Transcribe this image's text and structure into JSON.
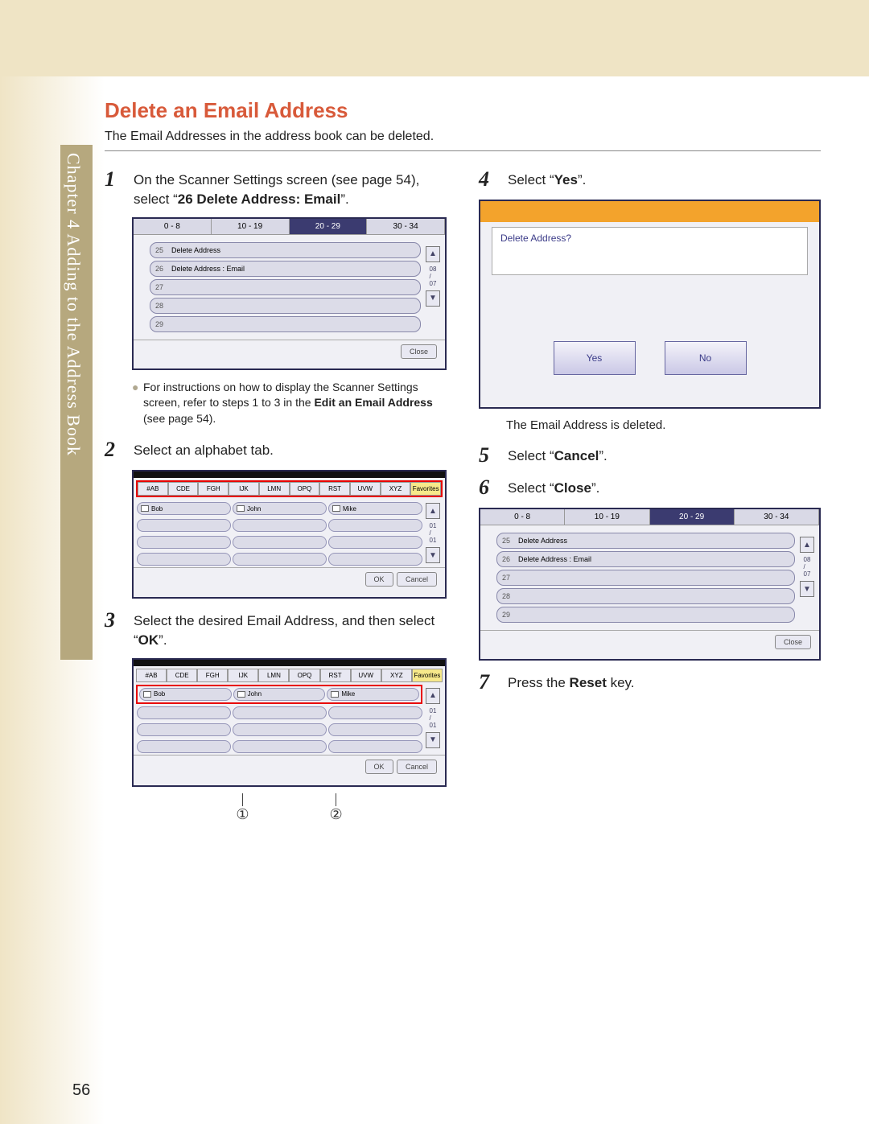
{
  "sidebar": {
    "label": "Chapter 4    Adding to the Address Book"
  },
  "title": "Delete an Email Address",
  "intro": "The Email Addresses in the address book can be deleted.",
  "steps": {
    "s1": {
      "num": "1",
      "text_a": "On the Scanner Settings screen (see page 54), select “",
      "text_b": "26 Delete Address: Email",
      "text_c": "”."
    },
    "s1_note": {
      "text_a": "For instructions on how to display the Scanner Settings screen, refer to steps 1 to 3 in the ",
      "text_b": "Edit an Email Address",
      "text_c": " (see page 54)."
    },
    "s2": {
      "num": "2",
      "text": "Select an alphabet tab."
    },
    "s3": {
      "num": "3",
      "text_a": "Select the desired Email Address, and then select “",
      "text_b": "OK",
      "text_c": "”."
    },
    "s4": {
      "num": "4",
      "text_a": "Select “",
      "text_b": "Yes",
      "text_c": "”."
    },
    "s4_result": "The Email Address is deleted.",
    "s5": {
      "num": "5",
      "text_a": "Select “",
      "text_b": "Cancel",
      "text_c": "”."
    },
    "s6": {
      "num": "6",
      "text_a": "Select “",
      "text_b": "Close",
      "text_c": "”."
    },
    "s7": {
      "num": "7",
      "text_a": "Press the ",
      "text_b": "Reset",
      "text_c": " key."
    }
  },
  "mock1": {
    "tabs": [
      "0 - 8",
      "10 - 19",
      "20 - 29",
      "30 - 34"
    ],
    "rows": [
      {
        "n": "25",
        "t": "Delete Address"
      },
      {
        "n": "26",
        "t": "Delete Address : Email"
      },
      {
        "n": "27",
        "t": ""
      },
      {
        "n": "28",
        "t": ""
      },
      {
        "n": "29",
        "t": ""
      }
    ],
    "close": "Close",
    "pager": "08\n/\n07"
  },
  "mock2": {
    "tabs": [
      "#AB",
      "CDE",
      "FGH",
      "IJK",
      "LMN",
      "OPQ",
      "RST",
      "UVW",
      "XYZ",
      "Favorites"
    ],
    "names": [
      "Bob",
      "John",
      "Mike"
    ],
    "ok": "OK",
    "cancel": "Cancel",
    "pager": "01\n/\n01"
  },
  "mock3": {
    "names": [
      "Bob",
      "John",
      "Mike"
    ],
    "ok": "OK",
    "cancel": "Cancel",
    "callout1": "①",
    "callout2": "②"
  },
  "mock4": {
    "question": "Delete Address?",
    "yes": "Yes",
    "no": "No"
  },
  "mock5": {
    "tabs": [
      "0 - 8",
      "10 - 19",
      "20 - 29",
      "30 - 34"
    ],
    "rows": [
      {
        "n": "25",
        "t": "Delete Address"
      },
      {
        "n": "26",
        "t": "Delete Address : Email"
      },
      {
        "n": "27",
        "t": ""
      },
      {
        "n": "28",
        "t": ""
      },
      {
        "n": "29",
        "t": ""
      }
    ],
    "close": "Close"
  },
  "page_number": "56"
}
